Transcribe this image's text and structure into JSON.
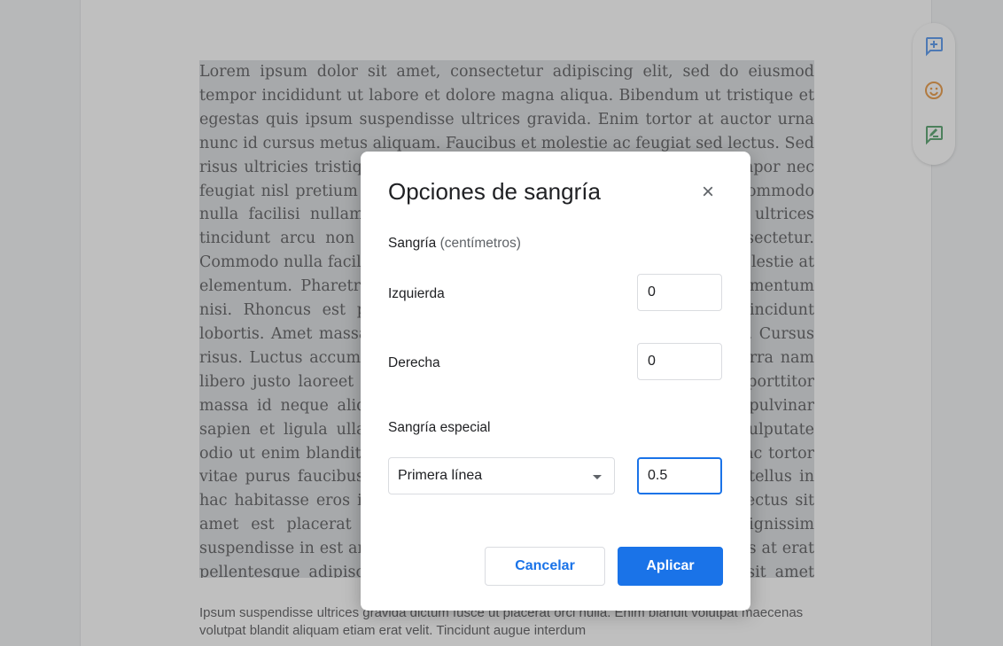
{
  "document": {
    "selected_paragraph": "Lorem ipsum dolor sit amet, consectetur adipiscing elit, sed do eiusmod tempor incididunt ut labore et dolore magna aliqua. Bibendum ut tristique et egestas quis ipsum suspendisse ultrices gravida. Enim tortor at auctor urna nunc id cursus metus aliquam. Faucibus et molestie ac feugiat sed lectus. Sed risus ultricies tristique nulla aliquet enim tortor. Purus in massa tempor nec feugiat nisl pretium fusce. Duis tristique sollicitudin nibh sit amet commodo nulla facilisi nullam vehicula. Id interdum velit laoreet id donec ultrices tincidunt arcu non sodales neque sodales ut etiam sit amet consectetur. Commodo nulla facilisi nullam vehicula ipsum a arcu cursus vitae. Molestie at elementum. Pharetra et ultrices neque ornare aenean euismod elementum nisi. Rhoncus est pellentesque elit ullamcorper dignissim cras tincidunt lobortis. Amet massa vitae tortor condimentum lacinia quis vel eros. Cursus risus. Luctus accumsan tortor posuere ac ut consequat semper viverra nam libero justo laoreet sit amet semper. Leo duis ut diam quam nulla porttitor massa id neque aliquam vestibulum morbi. Massa tincidunt nunc pulvinar sapien et ligula ullamcorper malesuada proin. At quis risus sed vulputate odio ut enim blandit volutpat maecenas. Vestibulum mattis. Nullam ac tortor vitae purus faucibus ornare suspendisse sed nisi lacus sed viverra tellus in hac habitasse eros in cursus turpis massa tincidunt dui ut ornare lectus sit amet est placerat in egestas erat imperdiet quam vulputate dignissim suspendisse in est ante in nibh mauris cursus mattis molestie a iaculis at erat pellentesque adipiscing commodo elit at imperdiet dui accumsan sit amet nulla facilisi morbi tempus iaculis urna id volutpat lacus laoreet non curabitur gravida arcu ac tortor dignissim convallis aenean et tortor at risus viverra adipiscing at in tellus integer feugiat scelerisque varius morbi enim nunc faucibus a pellentesque sit amet porttitor eget dolor morbi non arcu risus quis varius quam quisque id diam vel quam elementum pulvinar etiam non quam lacus suspendisse faucibus interdum posuere lorem ipsum dolor sit amet consectetur adipiscing elit duis tristique sollicitudin nibh sit amet commodo nulla facilisi nullam vehicula ipsum a arcu cursus vitae congue mauris rhoncus aenean vel elit scelerisque mauris pellentesque pulvinar pellentesque habitant morbi tristique senectus et netus et malesuada fames ac turpis egestas maecenas pharetra convallis posuere morbi leo urna molestie at elementum eu facilisis sed odio morbi quis commodo odio aenean sed adipiscing diam donec adipiscing tristique risus nec feugiat in fermentum posuere urna nec tincidunt praesent semper feugiat nibh sed pulvinar proin gravida hendrerit lectus a molestie lorem velit laoreet id donec ultrices tincidunt.",
    "next_paragraph": "Ipsum suspendisse ultrices gravida dictum fusce ut placerat orci nulla. Enim blandit volutpat maecenas volutpat blandit aliquam etiam erat velit. Tincidunt augue interdum"
  },
  "side_actions": {
    "add_comment_icon": "add-comment-icon",
    "emoji_icon": "emoji-icon",
    "suggest_edit_icon": "suggest-edit-icon"
  },
  "dialog": {
    "title": "Opciones de sangría",
    "close_icon": "×",
    "indent_section": {
      "label": "Sangría",
      "unit": "(centímetros)"
    },
    "left": {
      "label": "Izquierda",
      "value": "0"
    },
    "right": {
      "label": "Derecha",
      "value": "0"
    },
    "special_section_label": "Sangría especial",
    "special_type": {
      "selected": "Primera línea"
    },
    "special_value": "0.5",
    "cancel_label": "Cancelar",
    "apply_label": "Aplicar"
  },
  "colors": {
    "accent": "#1a73e8",
    "selection": "#cfd3d6",
    "overlay": "rgba(128,128,128,0.5)"
  }
}
